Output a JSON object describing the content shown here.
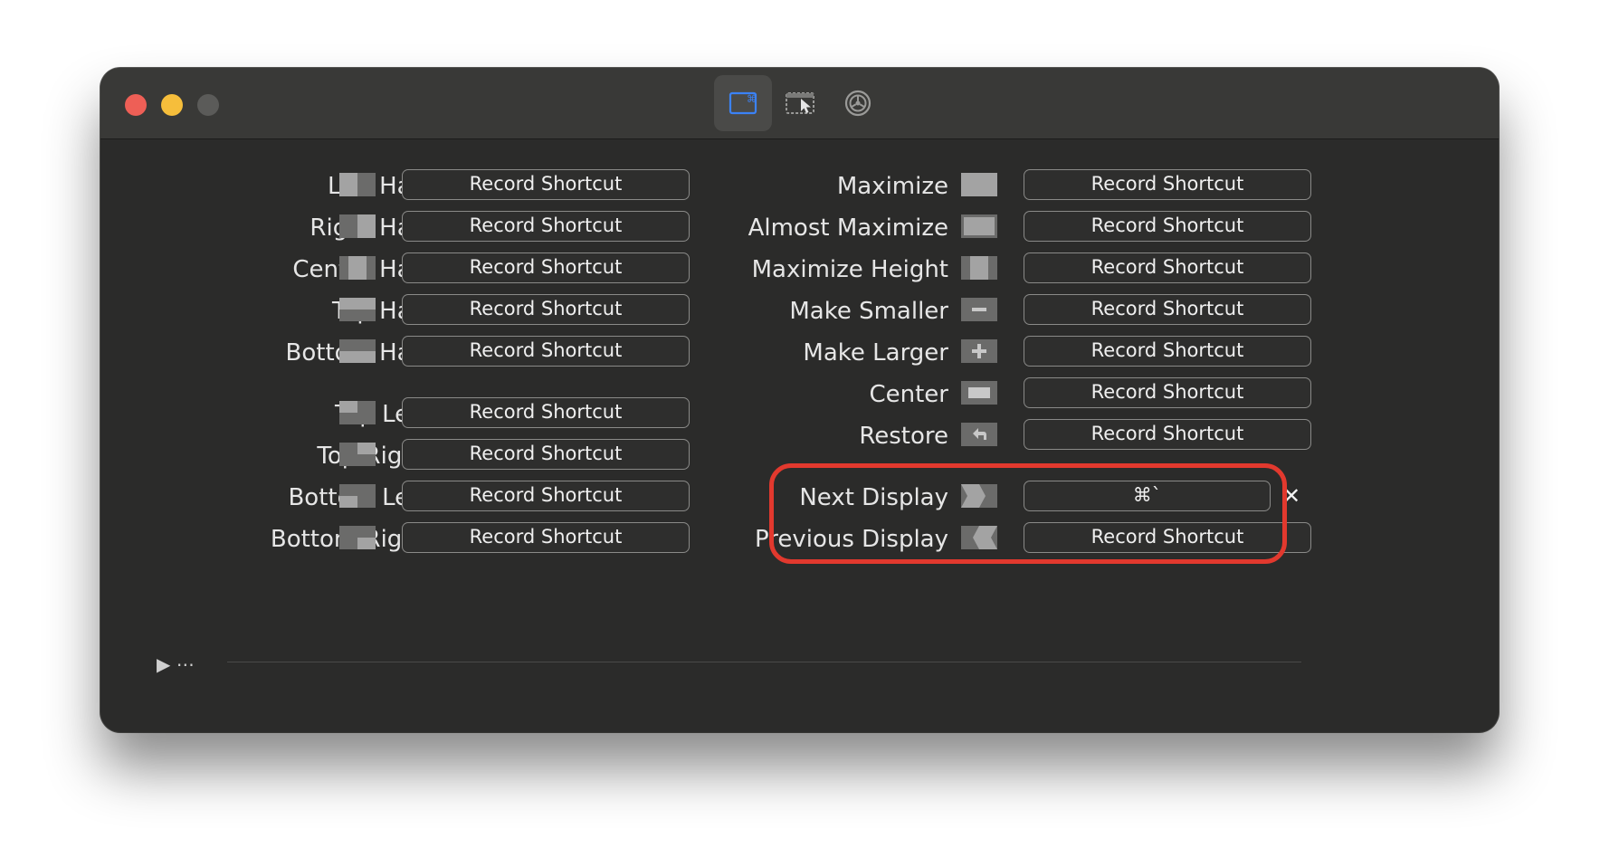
{
  "toolbar": {
    "tabs": [
      {
        "icon": "keyboard-shortcuts-icon"
      },
      {
        "icon": "snap-areas-icon"
      },
      {
        "icon": "settings-gear-icon"
      }
    ]
  },
  "left_column": [
    {
      "label": "Left Half",
      "shortcut": "Record Shortcut",
      "icon": "left-half-icon"
    },
    {
      "label": "Right Half",
      "shortcut": "Record Shortcut",
      "icon": "right-half-icon"
    },
    {
      "label": "Center Half",
      "shortcut": "Record Shortcut",
      "icon": "center-half-icon"
    },
    {
      "label": "Top Half",
      "shortcut": "Record Shortcut",
      "icon": "top-half-icon"
    },
    {
      "label": "Bottom Half",
      "shortcut": "Record Shortcut",
      "icon": "bottom-half-icon"
    },
    {
      "label": "Top Left",
      "shortcut": "Record Shortcut",
      "icon": "top-left-icon"
    },
    {
      "label": "Top Right",
      "shortcut": "Record Shortcut",
      "icon": "top-right-icon"
    },
    {
      "label": "Bottom Left",
      "shortcut": "Record Shortcut",
      "icon": "bottom-left-icon"
    },
    {
      "label": "Bottom Right",
      "shortcut": "Record Shortcut",
      "icon": "bottom-right-icon"
    }
  ],
  "right_column": [
    {
      "label": "Maximize",
      "shortcut": "Record Shortcut",
      "icon": "maximize-icon"
    },
    {
      "label": "Almost Maximize",
      "shortcut": "Record Shortcut",
      "icon": "almost-maximize-icon"
    },
    {
      "label": "Maximize Height",
      "shortcut": "Record Shortcut",
      "icon": "maximize-height-icon"
    },
    {
      "label": "Make Smaller",
      "shortcut": "Record Shortcut",
      "icon": "make-smaller-icon"
    },
    {
      "label": "Make Larger",
      "shortcut": "Record Shortcut",
      "icon": "make-larger-icon"
    },
    {
      "label": "Center",
      "shortcut": "Record Shortcut",
      "icon": "center-icon"
    },
    {
      "label": "Restore",
      "shortcut": "Record Shortcut",
      "icon": "restore-icon"
    },
    {
      "label": "Next Display",
      "shortcut": "⌘`",
      "icon": "next-display-icon"
    },
    {
      "label": "Previous Display",
      "shortcut": "Record Shortcut",
      "icon": "previous-display-icon"
    }
  ],
  "footer": {
    "disclosure": "▶ ⋯"
  },
  "colors": {
    "background": "#2b2b2a",
    "titlebar": "#393937",
    "highlight": "#e2392e",
    "accent": "#3b82f6"
  }
}
